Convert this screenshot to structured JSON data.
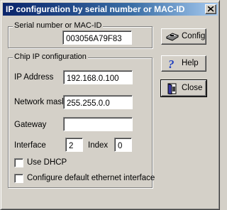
{
  "window": {
    "title": "IP configuration by serial number or MAC-ID"
  },
  "serial_group": {
    "label": "Serial number or MAC-ID",
    "value": "003056A79F83"
  },
  "chip_group": {
    "label": "Chip IP configuration",
    "ip_address_label": "IP Address",
    "ip_address_value": "192.168.0.100",
    "network_mask_label": "Network mask",
    "network_mask_value": "255.255.0.0",
    "gateway_label": "Gateway",
    "gateway_value": "",
    "interface_label": "Interface",
    "interface_value": "2",
    "index_label": "Index",
    "index_value": "0",
    "use_dhcp_label": "Use DHCP",
    "use_dhcp_checked": false,
    "configure_default_label": "Configure default ethernet interface",
    "configure_default_checked": false
  },
  "buttons": {
    "config_label": "Config",
    "config_icon": "config-device-icon",
    "help_label": "Help",
    "help_icon": "question-mark-icon",
    "close_label": "Close",
    "close_icon": "door-exit-icon"
  },
  "colors": {
    "face": "#d4d0c8",
    "title_start": "#0a246a",
    "title_end": "#a6caf0",
    "help_icon": "#2040c0"
  }
}
